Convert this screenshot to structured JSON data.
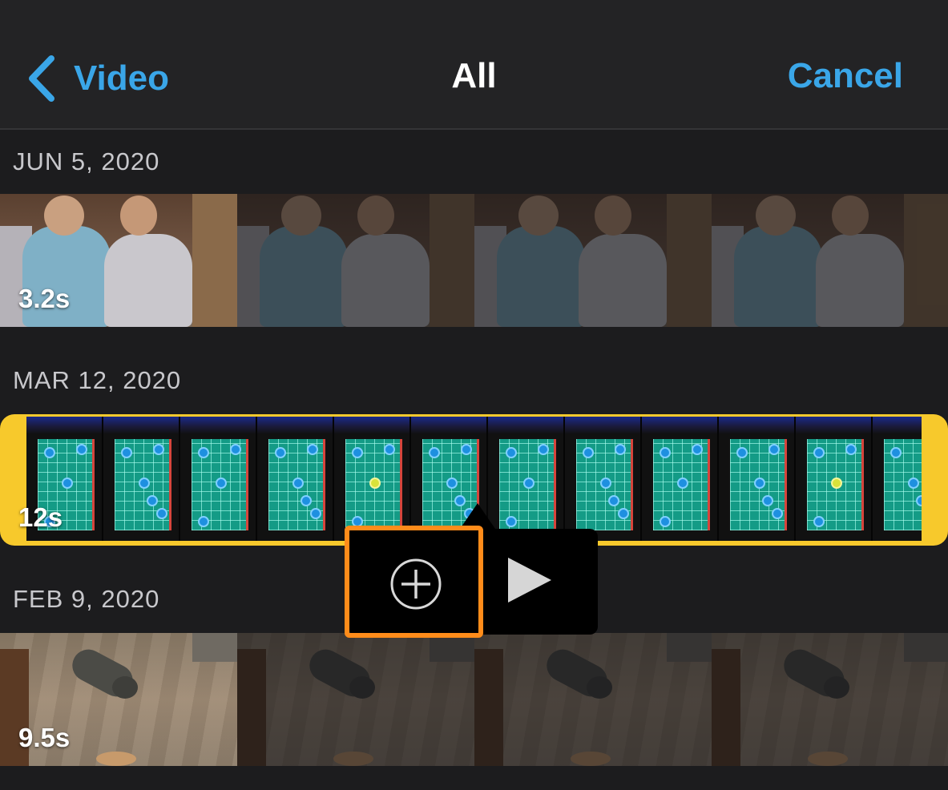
{
  "nav": {
    "back_label": "Video",
    "title": "All",
    "cancel_label": "Cancel"
  },
  "sections": [
    {
      "date": "JUN 5, 2020",
      "duration": "3.2s"
    },
    {
      "date": "MAR 12, 2020",
      "duration": "12s",
      "selected": true
    },
    {
      "date": "FEB 9, 2020",
      "duration": "9.5s"
    }
  ],
  "popup": {
    "add_icon": "plus-circle-icon",
    "play_icon": "play-icon",
    "highlight_color": "#ff8c1a"
  },
  "colors": {
    "accent": "#3aa6e8",
    "selection": "#f7c92c",
    "background": "#1c1c1e"
  }
}
